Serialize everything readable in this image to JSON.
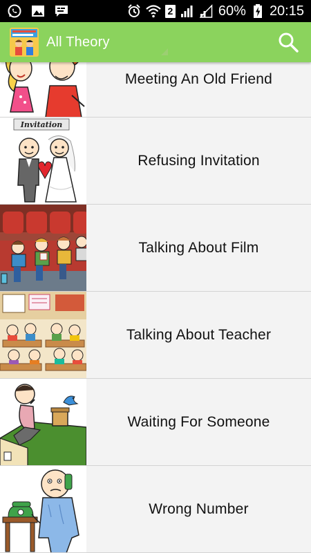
{
  "status_bar": {
    "icons_left": [
      "whatsapp-icon",
      "gallery-icon",
      "chat-icon"
    ],
    "icons_right": [
      "alarm-icon",
      "wifi-icon",
      "signal-icon",
      "signal-icon",
      "battery-charging-icon"
    ],
    "sim_label": "2",
    "battery": "60%",
    "time": "20:15"
  },
  "app_bar": {
    "title": "All Theory",
    "logo_icon": "app-logo-icon",
    "search_icon": "search-icon",
    "color": "#8bd35d"
  },
  "list": {
    "items": [
      {
        "label": "Meeting An Old Friend",
        "thumb": "friends-illustration"
      },
      {
        "label": "Refusing Invitation",
        "thumb": "wedding-couple-illustration",
        "thumb_caption": "Invitation"
      },
      {
        "label": "Talking About Film",
        "thumb": "cinema-kids-illustration"
      },
      {
        "label": "Talking About Teacher",
        "thumb": "classroom-illustration"
      },
      {
        "label": "Waiting For Someone",
        "thumb": "man-on-roof-illustration"
      },
      {
        "label": "Wrong Number",
        "thumb": "phone-call-illustration"
      }
    ]
  }
}
